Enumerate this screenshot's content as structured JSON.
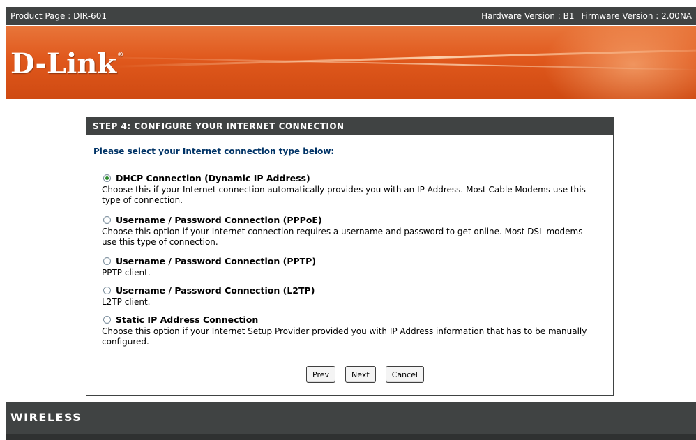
{
  "header": {
    "product": "Product Page : DIR-601",
    "hardware": "Hardware Version : B1",
    "firmware": "Firmware Version : 2.00NA"
  },
  "brand": {
    "logo": "D-Link",
    "trademark": "®"
  },
  "wizard": {
    "title": "STEP 4: CONFIGURE YOUR INTERNET CONNECTION",
    "prompt": "Please select your Internet connection type below:",
    "selected": "dhcp",
    "options": [
      {
        "id": "dhcp",
        "label": "DHCP Connection (Dynamic IP Address)",
        "description": "Choose this if your Internet connection automatically provides you with an IP Address. Most Cable Modems use this type of connection."
      },
      {
        "id": "pppoe",
        "label": "Username / Password Connection (PPPoE)",
        "description": "Choose this option if your Internet connection requires a username and password to get online. Most DSL modems use this type of connection."
      },
      {
        "id": "pptp",
        "label": "Username / Password Connection (PPTP)",
        "description": "PPTP client."
      },
      {
        "id": "l2tp",
        "label": "Username / Password Connection (L2TP)",
        "description": "L2TP client."
      },
      {
        "id": "static",
        "label": "Static IP Address Connection",
        "description": "Choose this option if your Internet Setup Provider provided you with IP Address information that has to be manually configured."
      }
    ],
    "buttons": {
      "prev": "Prev",
      "next": "Next",
      "cancel": "Cancel"
    }
  },
  "footer": {
    "label": "WIRELESS"
  },
  "colors": {
    "dark_bar": "#404343",
    "banner_orange": "#e0581c",
    "prompt_blue": "#003366",
    "radio_checked": "#2a8a2a"
  }
}
